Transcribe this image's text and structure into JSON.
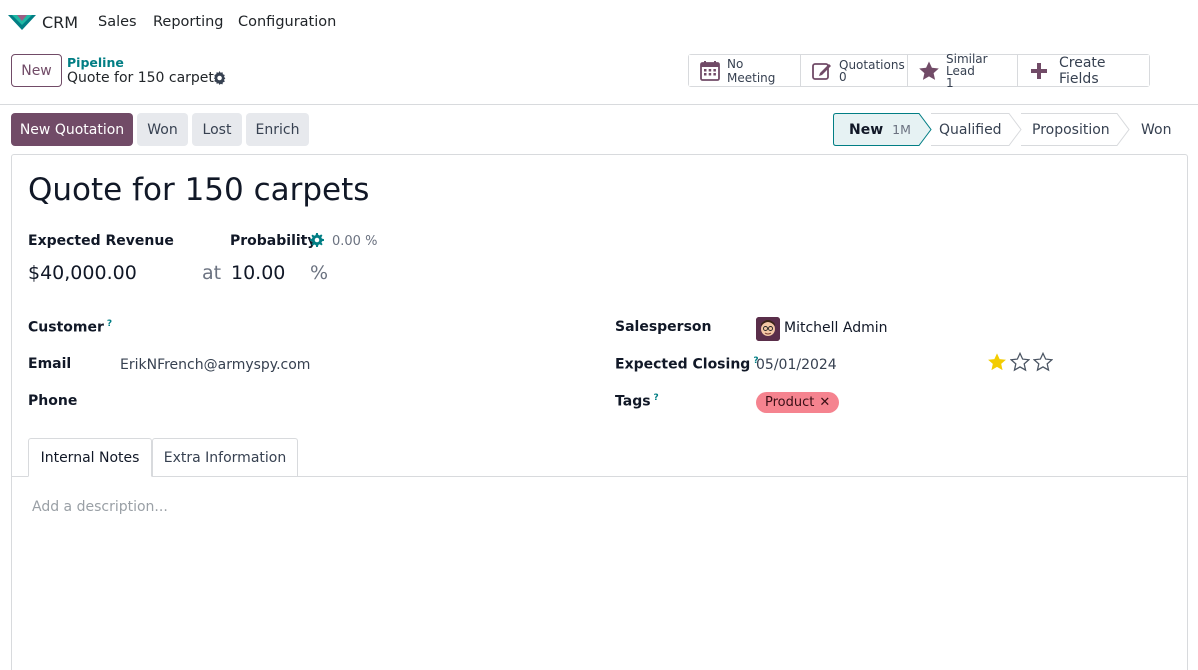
{
  "nav": {
    "app_name": "CRM",
    "menu": [
      "Sales",
      "Reporting",
      "Configuration"
    ]
  },
  "control": {
    "new_label": "New",
    "breadcrumb_parent": "Pipeline",
    "breadcrumb_current": "Quote for 150 carpets"
  },
  "smart_buttons": {
    "meeting": "No Meeting",
    "quotations_label": "Quotations",
    "quotations_count": "0",
    "similar_label": "Similar Lead",
    "similar_count": "1",
    "create_fields": "Create Fields"
  },
  "actions": {
    "new_quotation": "New Quotation",
    "won": "Won",
    "lost": "Lost",
    "enrich": "Enrich"
  },
  "stages": {
    "current": "New",
    "current_badge": "1M",
    "items": [
      "Qualified",
      "Proposition",
      "Won"
    ]
  },
  "form": {
    "title": "Quote for 150 carpets",
    "expected_revenue_label": "Expected Revenue",
    "expected_revenue": "$40,000.00",
    "at": "at",
    "probability_label": "Probability",
    "probability_auto": "0.00 %",
    "probability": "10.00",
    "percent": "%",
    "customer_label": "Customer",
    "email_label": "Email",
    "email": "ErikNFrench@armyspy.com",
    "phone_label": "Phone",
    "salesperson_label": "Salesperson",
    "salesperson": "Mitchell Admin",
    "expected_closing_label": "Expected Closing",
    "expected_closing": "05/01/2024",
    "tags_label": "Tags",
    "tag": "Product",
    "help": "?",
    "priority_stars": 1,
    "priority_max": 3
  },
  "tabs": {
    "internal_notes": "Internal Notes",
    "extra_info": "Extra Information"
  },
  "description_placeholder": "Add a description...",
  "colors": {
    "primary": "#714b67",
    "teal": "#017e84",
    "tag_bg": "#f5838f",
    "star": "#f3cc00"
  }
}
